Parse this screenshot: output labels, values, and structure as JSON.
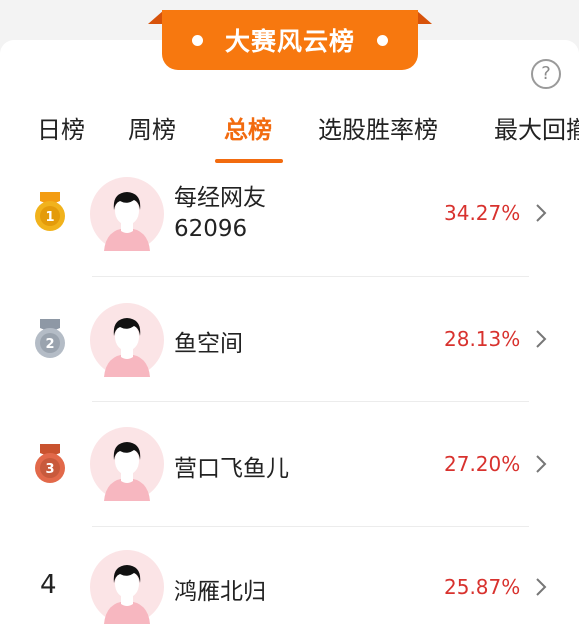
{
  "banner": {
    "title": "大赛风云榜"
  },
  "help": {
    "icon": "question-mark-icon",
    "label": "?"
  },
  "tabs": [
    {
      "label": "日榜",
      "active": false
    },
    {
      "label": "周榜",
      "active": false
    },
    {
      "label": "总榜",
      "active": true
    },
    {
      "label": "选股胜率榜",
      "active": false
    },
    {
      "label": "最大回撤",
      "active": false
    }
  ],
  "rows": [
    {
      "rank": "1",
      "badge": "gold-medal-icon",
      "name_line1": "每经网友",
      "name_line2": "62096",
      "rate": "34.27%"
    },
    {
      "rank": "2",
      "badge": "silver-medal-icon",
      "name_line1": "鱼空间",
      "rate": "28.13%"
    },
    {
      "rank": "3",
      "badge": "bronze-medal-icon",
      "name_line1": "营口飞鱼儿",
      "rate": "27.20%"
    },
    {
      "rank": "4",
      "badge": "",
      "name_line1": "鸿雁北归",
      "rate": "25.87%"
    }
  ],
  "colors": {
    "accent": "#f26b0f",
    "banner": "#f7780f",
    "rate": "#d8322e",
    "gold": "#f1b21c",
    "silver": "#b4bcc6",
    "bronze": "#e2694a"
  }
}
